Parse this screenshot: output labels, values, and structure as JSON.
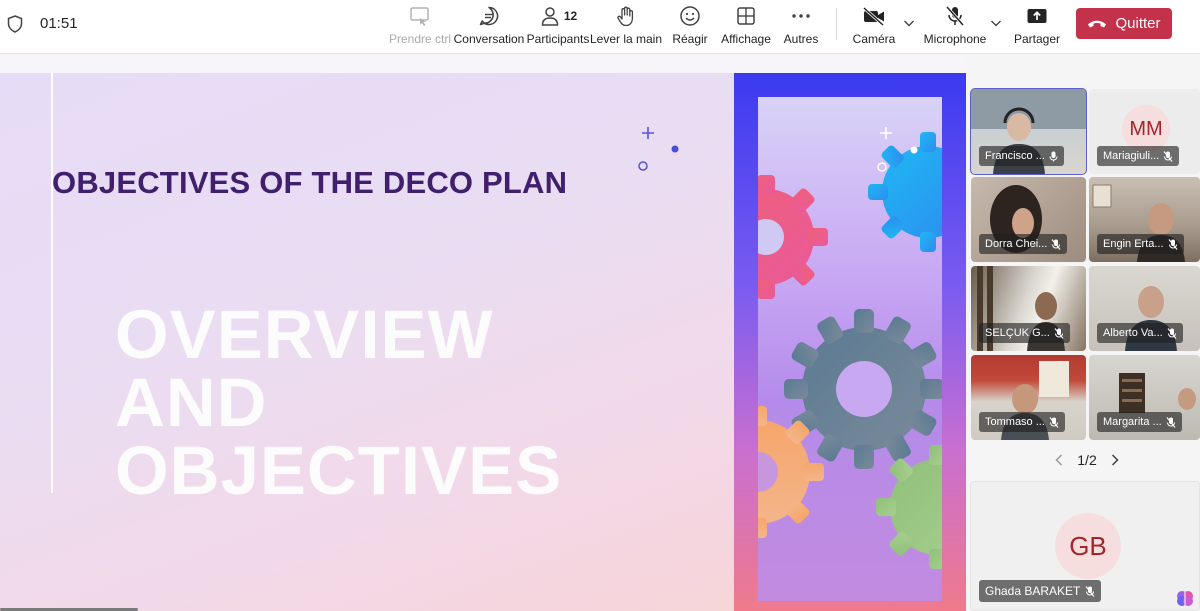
{
  "header": {
    "timer": "01:51",
    "buttons": [
      {
        "id": "take-control",
        "label": "Prendre ctrl"
      },
      {
        "id": "chat",
        "label": "Conversation"
      },
      {
        "id": "participants",
        "label": "Participants",
        "count": "12"
      },
      {
        "id": "raise-hand",
        "label": "Lever la main"
      },
      {
        "id": "react",
        "label": "Réagir"
      },
      {
        "id": "view",
        "label": "Affichage"
      },
      {
        "id": "more",
        "label": "Autres"
      },
      {
        "id": "camera",
        "label": "Caméra"
      },
      {
        "id": "microphone",
        "label": "Microphone"
      },
      {
        "id": "share",
        "label": "Partager"
      }
    ],
    "quit_label": "Quitter",
    "quit_color": "#c4314b"
  },
  "slide": {
    "title": "OBJECTIVES OF THE DECO PLAN",
    "big_lines": [
      "OVERVIEW",
      "AND",
      "OBJECTIVES"
    ],
    "title_color": "#40206d"
  },
  "participants": {
    "tiles": [
      {
        "name": "Francisco ...",
        "active": true
      },
      {
        "name": "Mariagiuli...",
        "initials": "MM"
      },
      {
        "name": "Dorra Chei..."
      },
      {
        "name": "Engin Erta..."
      },
      {
        "name": "SELÇUK G..."
      },
      {
        "name": "Alberto Va..."
      },
      {
        "name": "Tommaso ..."
      },
      {
        "name": "Margarita ..."
      }
    ],
    "page": "1/2",
    "featured": {
      "name": "Ghada BARAKET",
      "initials": "GB"
    }
  }
}
